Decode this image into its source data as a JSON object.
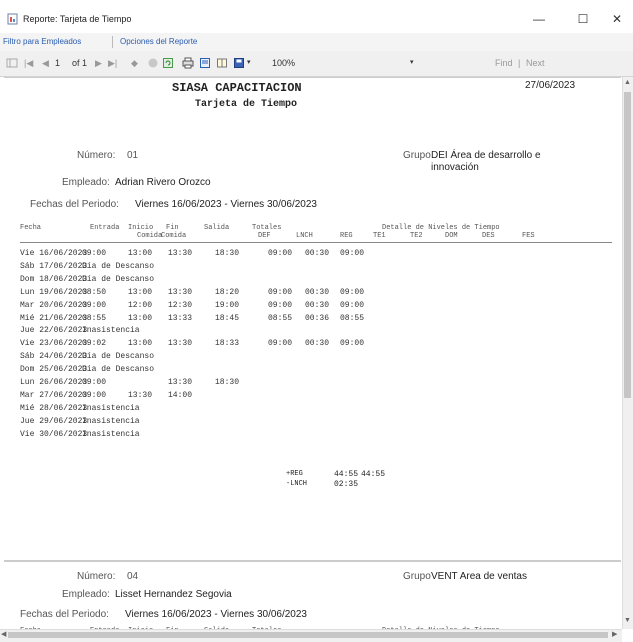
{
  "window": {
    "title": "Reporte: Tarjeta de Tiempo",
    "minimize": "—",
    "maximize": "☐",
    "close": "✕"
  },
  "menubar": {
    "items": [
      "Filtro para Empleados",
      "Opciones del Reporte"
    ]
  },
  "toolbar": {
    "current_page": "1",
    "of_pages": "of 1",
    "zoom": "100%",
    "find": "Find",
    "find_sep": "|",
    "next": "Next"
  },
  "report": {
    "company": "SIASA CAPACITACION",
    "subtitle": "Tarjeta de Tiempo",
    "date": "27/06/2023",
    "columns": {
      "fecha": "Fecha",
      "entrada": "Entrada",
      "inicio": "Inicio",
      "comida": "Comida",
      "fin": "Fin",
      "comida2": "Comida",
      "salida": "Salida",
      "totales": "Totales",
      "def": "DEF",
      "lnch": "LNCH",
      "detalle": "Detalle de Niveles de Tiempo",
      "reg": "REG",
      "te1": "TE1",
      "te2": "TE2",
      "dom": "DOM",
      "des": "DES",
      "fes": "FES"
    },
    "employees": [
      {
        "numero_label": "Número:",
        "numero": "01",
        "grupo_label": "Grupo",
        "grupo": "DEI Área de desarrollo e innovación",
        "empleado_label": "Empleado:",
        "empleado": "Adrian Rivero Orozco",
        "periodo_label": "Fechas del Periodo:",
        "periodo": "Viernes 16/06/2023 - Viernes 30/06/2023",
        "rows": [
          [
            "Vie 16/06/2023",
            "09:00",
            "13:00",
            "13:30",
            "18:30",
            "09:00",
            "00:30",
            "09:00"
          ],
          [
            "Sáb 17/06/2023",
            "Día de Descanso",
            "",
            "",
            "",
            "",
            "",
            ""
          ],
          [
            "Dom 18/06/2023",
            "Día de Descanso",
            "",
            "",
            "",
            "",
            "",
            ""
          ],
          [
            "Lun 19/06/2023",
            "08:50",
            "13:00",
            "13:30",
            "18:20",
            "09:00",
            "00:30",
            "09:00"
          ],
          [
            "Mar 20/06/2023",
            "09:00",
            "12:00",
            "12:30",
            "19:00",
            "09:00",
            "00:30",
            "09:00"
          ],
          [
            "Mié 21/06/2023",
            "08:55",
            "13:00",
            "13:33",
            "18:45",
            "08:55",
            "00:36",
            "08:55"
          ],
          [
            "Jue 22/06/2023",
            "Inasistencia",
            "",
            "",
            "",
            "",
            "",
            ""
          ],
          [
            "Vie 23/06/2023",
            "09:02",
            "13:00",
            "13:30",
            "18:33",
            "09:00",
            "00:30",
            "09:00"
          ],
          [
            "Sáb 24/06/2023",
            "Día de Descanso",
            "",
            "",
            "",
            "",
            "",
            ""
          ],
          [
            "Dom 25/06/2023",
            "Día de Descanso",
            "",
            "",
            "",
            "",
            "",
            ""
          ],
          [
            "Lun 26/06/2023",
            "09:00",
            "",
            "13:30",
            "18:30",
            "",
            "",
            ""
          ],
          [
            "Mar 27/06/2023",
            "09:00",
            "13:30",
            "14:00",
            "",
            "",
            "",
            ""
          ],
          [
            "Mié 28/06/2023",
            "Inasistencia",
            "",
            "",
            "",
            "",
            "",
            ""
          ],
          [
            "Jue 29/06/2023",
            "Inasistencia",
            "",
            "",
            "",
            "",
            "",
            ""
          ],
          [
            "Vie 30/06/2023",
            "Inasistencia",
            "",
            "",
            "",
            "",
            "",
            ""
          ]
        ],
        "totals": {
          "reg_label": "+REG",
          "reg_def": "44:55",
          "reg_reg": "44:55",
          "lnch_label": "-LNCH",
          "lnch_def": "02:35"
        }
      },
      {
        "numero_label": "Número:",
        "numero": "04",
        "grupo_label": "Grupo",
        "grupo": "VENT Area de ventas",
        "empleado_label": "Empleado:",
        "empleado": "Lisset Hernandez Segovia",
        "periodo_label": "Fechas del Periodo:",
        "periodo": "Viernes 16/06/2023 - Viernes 30/06/2023",
        "rows": []
      }
    ]
  }
}
